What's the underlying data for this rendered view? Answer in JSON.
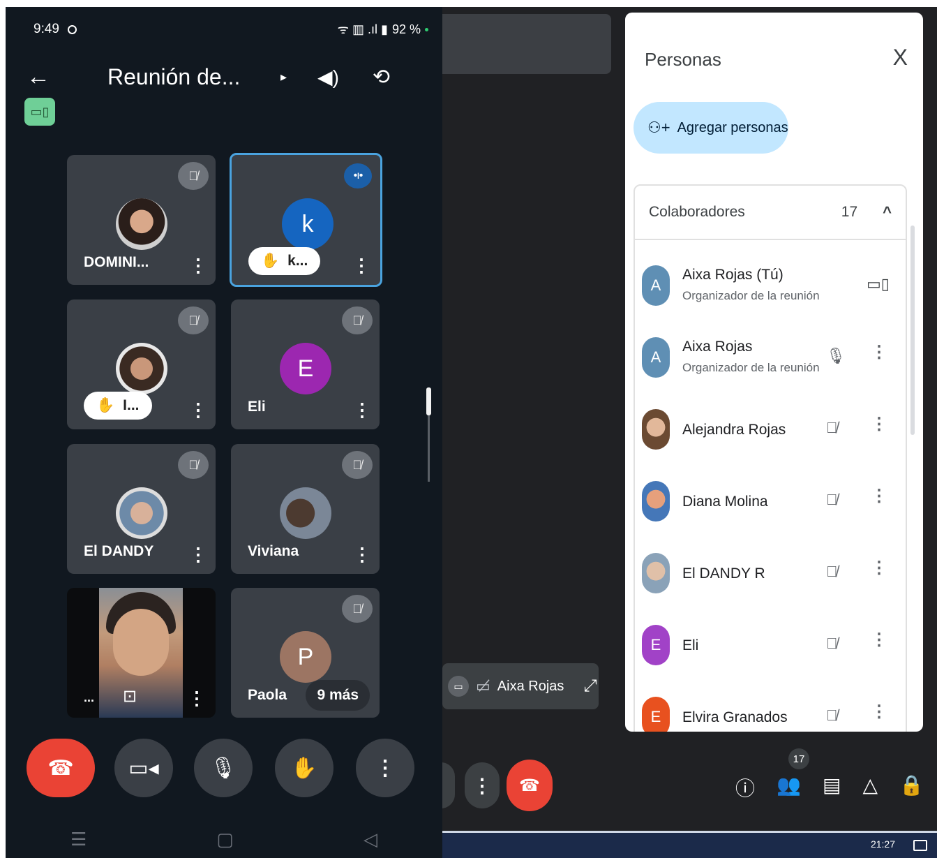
{
  "phone": {
    "status": {
      "time": "9:49",
      "battery": "92 %",
      "signal_icons": "ᯤ ▥ .ıl ▮"
    },
    "header": {
      "back_icon": "←",
      "title": "Reunión de...",
      "title_arrow": "▸",
      "speaker_icon": "◀)",
      "flip_icon": "⟲"
    },
    "cast_icon": "▭▯",
    "tiles": [
      {
        "name": "DOMINI...",
        "muted": true
      },
      {
        "initial": "k",
        "name": "k...",
        "raised_hand": true,
        "speaking": true
      },
      {
        "name": "I...",
        "raised_hand": true,
        "muted": true
      },
      {
        "initial": "E",
        "name": "Eli",
        "muted": true
      },
      {
        "name": "El DANDY",
        "muted": true
      },
      {
        "name": "Viviana",
        "muted": true
      },
      {
        "name": "...",
        "video": true
      },
      {
        "initial": "P",
        "name": "Paola",
        "muted": true,
        "extra": "9 más"
      }
    ],
    "icons": {
      "mute": "🎙̸",
      "more": "⋮",
      "hand": "✋",
      "speaking": "•ı•",
      "capture": "⊡"
    },
    "controls": {
      "end": "☎",
      "camera": "▭◂",
      "mic": "🎙",
      "hand": "✋",
      "more": "⋮"
    },
    "nav": {
      "recent": "☰",
      "home": "▢",
      "back": "◁"
    },
    "colors": {
      "bg": "#111820",
      "tile": "#3a3f46",
      "active_border": "#4aa3df",
      "avatar_k": "#1565c0",
      "avatar_e": "#9c27b0",
      "avatar_p": "#9c7563",
      "end_call": "#ea4335"
    }
  },
  "desktop": {
    "self_view": {
      "name": "Aixa Rojas",
      "expand_icon": "⤢"
    },
    "panel": {
      "title": "Personas",
      "close_icon": "X",
      "add_button": "Agregar personas",
      "add_icon": "⚇+",
      "section": {
        "label": "Colaboradores",
        "count": "17",
        "chevron": "^"
      },
      "people": [
        {
          "name": "Aixa Rojas (Tú)",
          "role": "Organizador de la reunión",
          "initial": "A",
          "color": "#5f8fb4",
          "device_icon": "▭▯"
        },
        {
          "name": "Aixa Rojas",
          "role": "Organizador de la reunión",
          "initial": "A",
          "color": "#5f8fb4",
          "mic": "🎙",
          "more": "⋮"
        },
        {
          "name": "Alejandra Rojas",
          "initial": "",
          "color": "#a47c5c",
          "mic": "🎙̸",
          "more": "⋮"
        },
        {
          "name": "Diana Molina",
          "initial": "",
          "color": "#d08a6a",
          "mic": "🎙̸",
          "more": "⋮"
        },
        {
          "name": "El DANDY R",
          "initial": "",
          "color": "#8aa2b8",
          "mic": "🎙̸",
          "more": "⋮"
        },
        {
          "name": "Eli",
          "initial": "E",
          "color": "#a142c7",
          "mic": "🎙̸",
          "more": "⋮"
        },
        {
          "name": "Elvira Granados",
          "initial": "E",
          "color": "#e8511f",
          "mic": "🎙̸",
          "more": "⋮"
        }
      ]
    },
    "bottom": {
      "more": "⋮",
      "end": "☎",
      "people_badge": "17",
      "info_icon": "ⓘ",
      "people_icon": "👥",
      "chat_icon": "▤",
      "activities_icon": "△",
      "lock_icon": "🔒"
    },
    "taskbar": {
      "clock": "21:27"
    }
  }
}
